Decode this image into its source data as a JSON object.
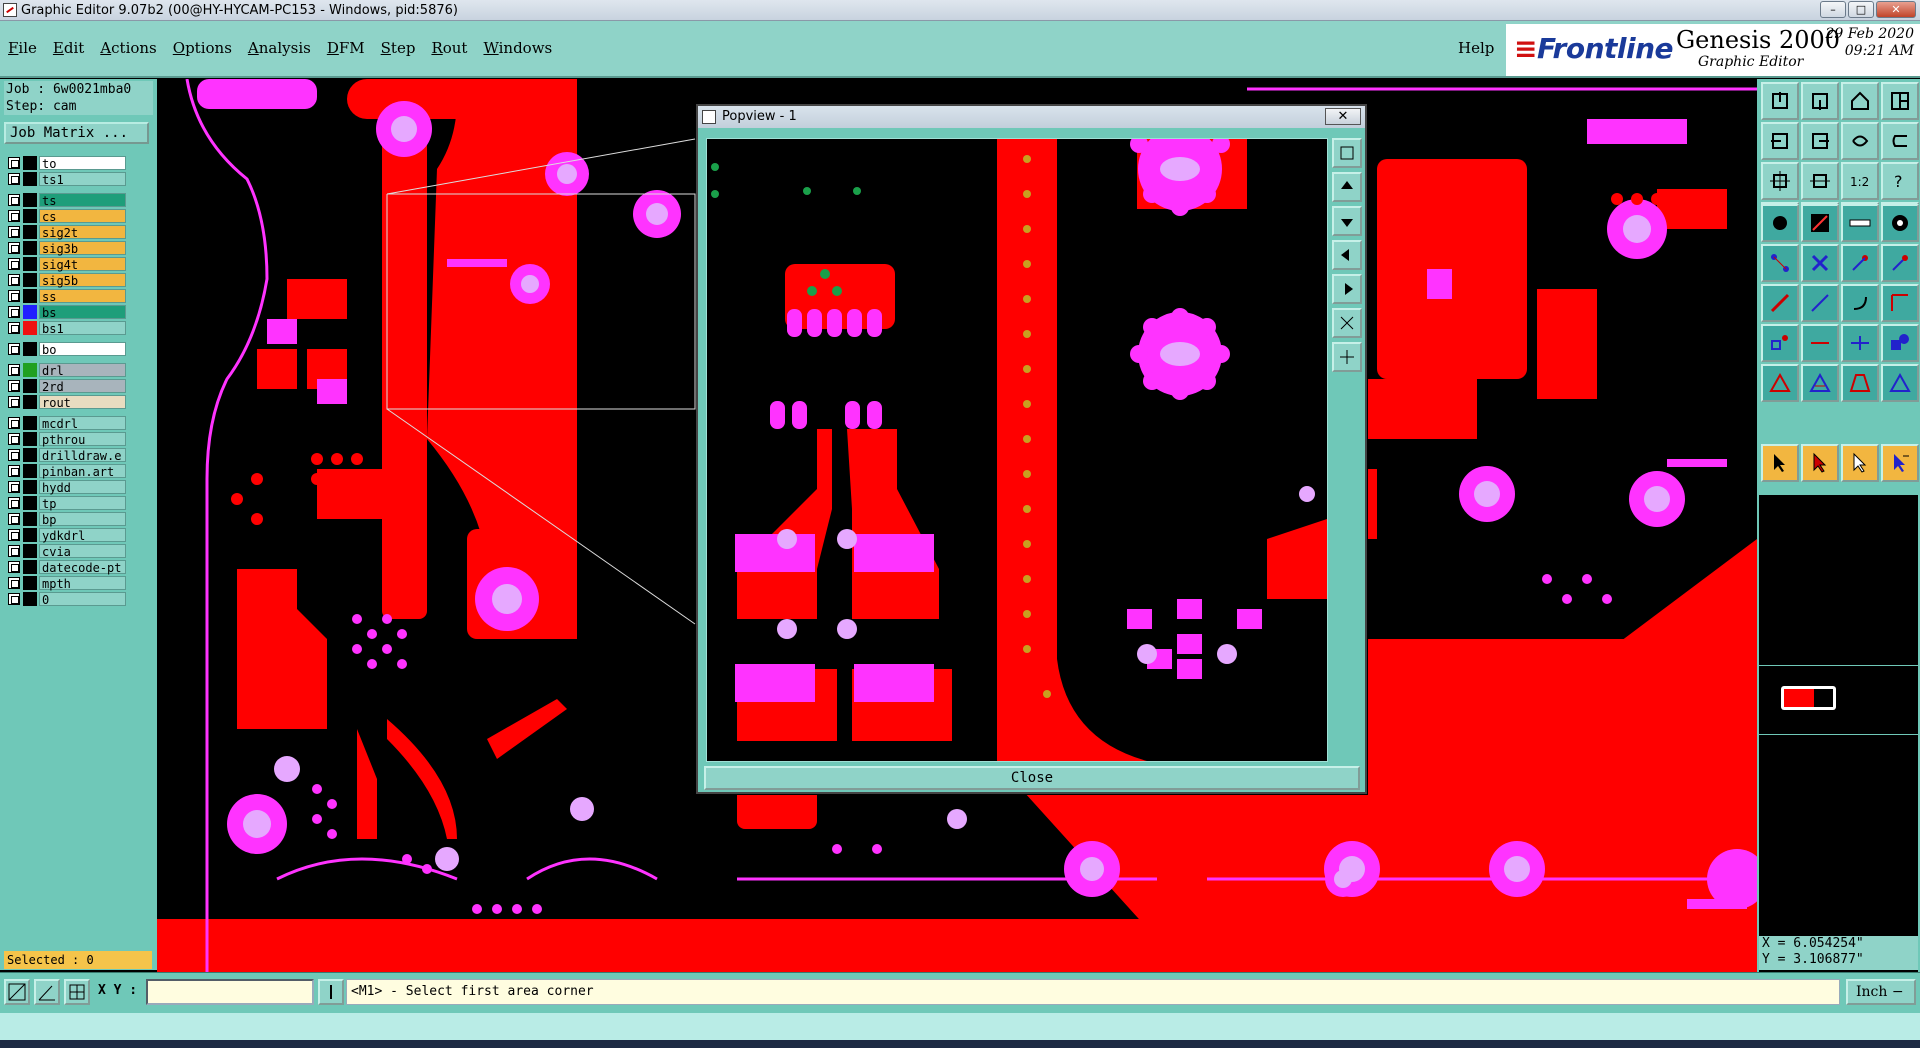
{
  "window": {
    "title": "Graphic Editor 9.07b2 (00@HY-HYCAM-PC153 - Windows, pid:5876)"
  },
  "menu": {
    "items": [
      "File",
      "Edit",
      "Actions",
      "Options",
      "Analysis",
      "DFM",
      "Step",
      "Rout",
      "Windows"
    ],
    "help": "Help"
  },
  "brand": {
    "logo": "Frontline",
    "product": "Genesis 2000",
    "subtitle": "Graphic Editor",
    "date": "29 Feb 2020",
    "time": "09:21 AM"
  },
  "job": {
    "job_line": "Job : 6w0021mba0",
    "step_line": "Step: cam",
    "matrix_button": "Job Matrix ..."
  },
  "layers": [
    {
      "name": "to",
      "color": "#000000",
      "bg": "#ffffff"
    },
    {
      "name": "ts1",
      "color": "#000000",
      "bg": "#8fd3c8"
    },
    {
      "name": "ts",
      "color": "#000000",
      "bg": "#1e9e7a"
    },
    {
      "name": "cs",
      "color": "#000000",
      "bg": "#f2b640"
    },
    {
      "name": "sig2t",
      "color": "#000000",
      "bg": "#f2b640"
    },
    {
      "name": "sig3b",
      "color": "#000000",
      "bg": "#f2b640"
    },
    {
      "name": "sig4t",
      "color": "#000000",
      "bg": "#f2b640"
    },
    {
      "name": "sig5b",
      "color": "#000000",
      "bg": "#f2b640"
    },
    {
      "name": "ss",
      "color": "#000000",
      "bg": "#f2b640"
    },
    {
      "name": "bs",
      "color": "#2020ff",
      "bg": "#1e9e7a"
    },
    {
      "name": "bs1",
      "color": "#ee1111",
      "bg": "#8fd3c8"
    },
    {
      "name": "bo",
      "color": "#000000",
      "bg": "#ffffff"
    },
    {
      "name": "drl",
      "color": "#20a020",
      "bg": "#a8b4bc"
    },
    {
      "name": "2rd",
      "color": "#000000",
      "bg": "#a8b4bc"
    },
    {
      "name": "rout",
      "color": "#000000",
      "bg": "#e8dcc0"
    },
    {
      "name": "mcdrl",
      "color": "#000000",
      "bg": "#8fd3c8"
    },
    {
      "name": "pthrou",
      "color": "#000000",
      "bg": "#8fd3c8"
    },
    {
      "name": "drilldraw.e",
      "color": "#000000",
      "bg": "#8fd3c8"
    },
    {
      "name": "pinban.art",
      "color": "#000000",
      "bg": "#8fd3c8"
    },
    {
      "name": "hydd",
      "color": "#000000",
      "bg": "#8fd3c8"
    },
    {
      "name": "tp",
      "color": "#000000",
      "bg": "#8fd3c8"
    },
    {
      "name": "bp",
      "color": "#000000",
      "bg": "#8fd3c8"
    },
    {
      "name": "ydkdrl",
      "color": "#000000",
      "bg": "#8fd3c8"
    },
    {
      "name": "cvia",
      "color": "#000000",
      "bg": "#8fd3c8"
    },
    {
      "name": "datecode-pt",
      "color": "#000000",
      "bg": "#8fd3c8"
    },
    {
      "name": "mpth",
      "color": "#000000",
      "bg": "#8fd3c8"
    },
    {
      "name": "0",
      "color": "#000000",
      "bg": "#8fd3c8"
    }
  ],
  "selected": "Selected : 0",
  "popview": {
    "title": "Popview - 1",
    "close_label": "Close"
  },
  "coords": {
    "x": "X = 6.054254\"",
    "y": "Y = 3.106877\""
  },
  "bottom": {
    "xy_label": "X Y :",
    "xy_value": "",
    "message": "<M1> - Select first area corner",
    "unit": "Inch"
  },
  "colors": {
    "panel": "#6fc8b8",
    "copper": "#ff0000",
    "pad": "#ff33ff",
    "drill": "#e6a8ff"
  }
}
